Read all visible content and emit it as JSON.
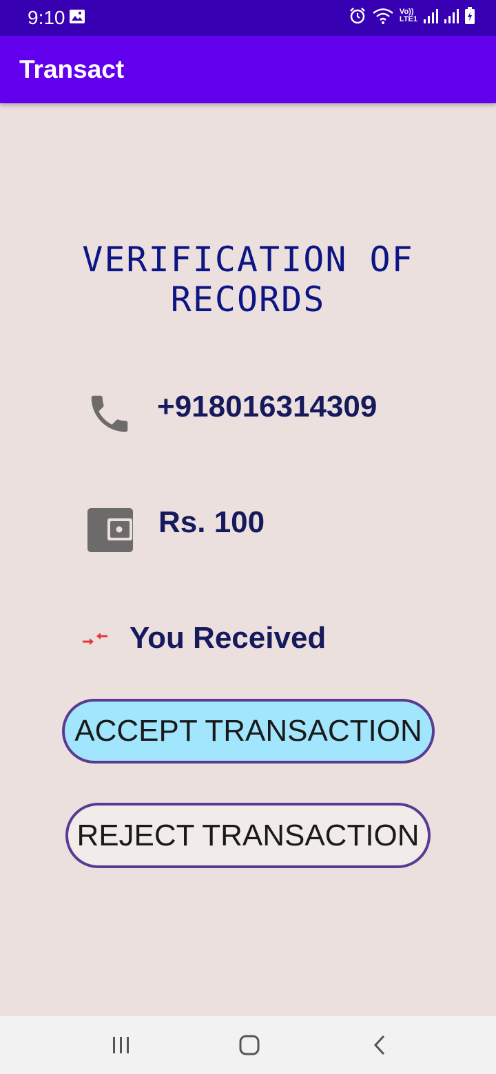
{
  "status_bar": {
    "time": "9:10",
    "icons": [
      "gallery-icon",
      "alarm-icon",
      "wifi-icon",
      "volte-icon",
      "signal-icon",
      "signal-icon",
      "battery-icon"
    ],
    "volte_label": "Vo))",
    "lte_label": "LTE1"
  },
  "app_bar": {
    "title": "Transact"
  },
  "main": {
    "heading": "VERIFICATION OF RECORDS",
    "phone": {
      "icon": "phone-icon",
      "value": "+918016314309"
    },
    "amount": {
      "icon": "wallet-icon",
      "value": "Rs. 100"
    },
    "transaction_type": {
      "icon": "compress-arrows-icon",
      "value": "You Received"
    },
    "accept_label": "ACCEPT TRANSACTION",
    "reject_label": "REJECT TRANSACTION"
  },
  "nav_bar": {
    "icons": [
      "recent-apps-icon",
      "home-icon",
      "back-icon"
    ]
  },
  "colors": {
    "status_bar": "#3700b3",
    "app_bar": "#6200ee",
    "background": "#ece0df",
    "heading": "#0d1585",
    "text": "#161a5c",
    "accept_button": "#a1e6fd",
    "icon_gray": "#6d6a6a",
    "arrow_red": "#e53935"
  }
}
